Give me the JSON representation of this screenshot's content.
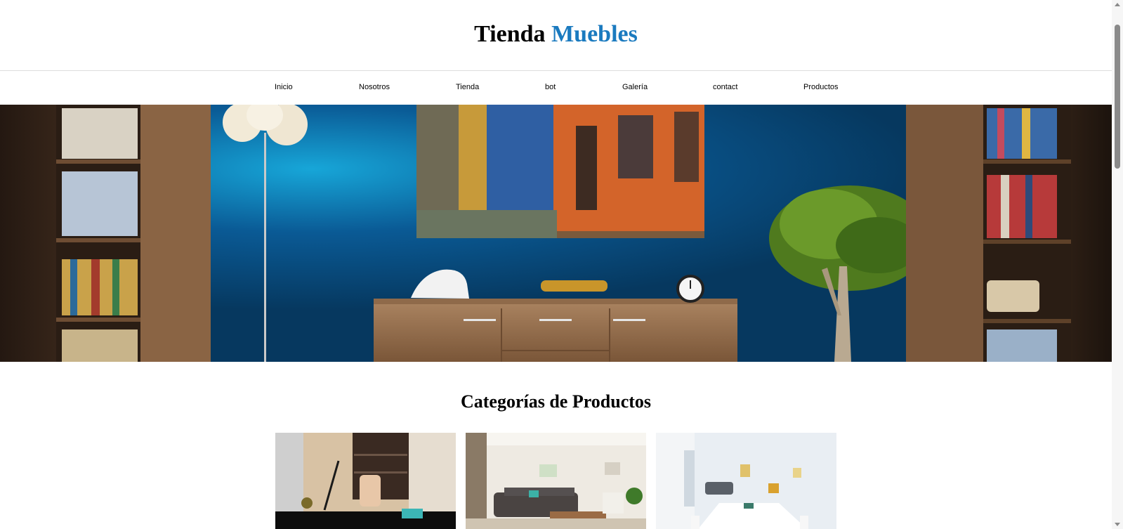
{
  "header": {
    "logo_part1": "Tienda",
    "logo_part2": "Muebles",
    "accent_color": "#1a7abf"
  },
  "nav": {
    "items": [
      "Inicio",
      "Nosotros",
      "Tienda",
      "bot",
      "Galería",
      "contact",
      "Productos"
    ]
  },
  "hero": {
    "image": "living-room-blue-wall-photo"
  },
  "categories": {
    "title": "Categorías de Productos",
    "cards": [
      {
        "image": "home-office-photo"
      },
      {
        "image": "living-room-sofa-photo"
      },
      {
        "image": "meeting-room-photo"
      }
    ]
  }
}
